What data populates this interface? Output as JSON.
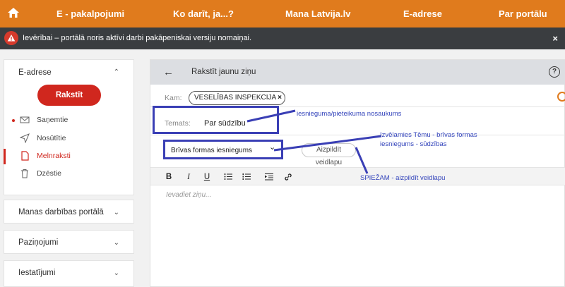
{
  "topnav": {
    "items": [
      "E - pakalpojumi",
      "Ko darīt, ja...?",
      "Mana Latvija.lv",
      "E-adrese",
      "Par portālu"
    ]
  },
  "alert": {
    "text": "Ievērībai – portālā noris aktīvi darbi pakāpeniskai versiju nomaiņai.",
    "close": "×"
  },
  "sidebar": {
    "title": "E-adrese",
    "write_label": "Rakstīt",
    "items": [
      {
        "label": "Saņemtie",
        "icon": "envelope-icon"
      },
      {
        "label": "Nosūtītie",
        "icon": "send-icon"
      },
      {
        "label": "Melnraksti",
        "icon": "draft-icon"
      },
      {
        "label": "Dzēstie",
        "icon": "trash-icon"
      }
    ],
    "sections": [
      "Manas darbības portālā",
      "Paziņojumi",
      "Iestatījumi"
    ]
  },
  "compose": {
    "title": "Rakstīt jaunu ziņu",
    "to_label": "Kam:",
    "recipient": "VESELĪBAS INSPEKCIJA",
    "subject_label": "Temats:",
    "subject_value": "Par sūdzību",
    "form_type": "Brīvas formas iesniegums",
    "fill_form": "Aizpildīt veidlapu",
    "editor_placeholder": "Ievadiet ziņu..."
  },
  "annotations": {
    "subject_note": "iesnieguma/pieteikuma nosaukums",
    "form_note_1": "Izvēlamies Tēmu - brīvas formas",
    "form_note_2": "iesniegums - sūdzības",
    "button_note": "SPIEŽAM - aizpildīt veidlapu"
  },
  "colors": {
    "brand_orange": "#e07b1d",
    "alert_bg": "#3a3d40",
    "accent_red": "#d0271e",
    "annotation_blue": "#3a3fb5"
  }
}
